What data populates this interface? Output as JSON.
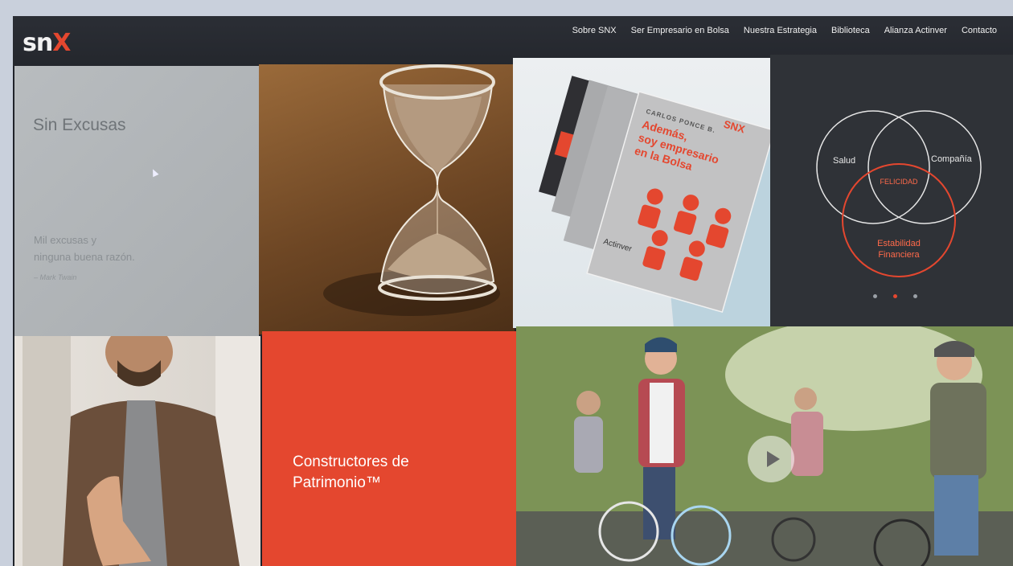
{
  "brand": {
    "logo_text": "sn",
    "logo_x": "X"
  },
  "nav": {
    "items": [
      {
        "label": "Sobre SNX"
      },
      {
        "label": "Ser Empresario en Bolsa"
      },
      {
        "label": "Nuestra Estrategia"
      },
      {
        "label": "Biblioteca"
      },
      {
        "label": "Alianza Actinver"
      },
      {
        "label": "Contacto"
      }
    ]
  },
  "tiles": {
    "sin_excusas": {
      "title": "Sin Excusas",
      "quote_line1": "Mil excusas y",
      "quote_line2": "ninguna buena razón.",
      "author": "– Mark Twain"
    },
    "books": {
      "author": "CARLOS PONCE B.",
      "title_line1": "Además,",
      "title_line2": "soy empresario",
      "title_line3": "en la Bolsa",
      "brand": "Actinver",
      "logo": "SNX"
    },
    "venn": {
      "salud": "Salud",
      "compania": "Compañía",
      "felicidad": "FELICIDAD",
      "estabilidad_line1": "Estabilidad",
      "estabilidad_line2": "Financiera"
    },
    "constructores": {
      "line1": "Constructores de",
      "line2": "Patrimonio™"
    }
  },
  "colors": {
    "accent": "#e4472f",
    "nav_bg": "#2b2e35"
  }
}
